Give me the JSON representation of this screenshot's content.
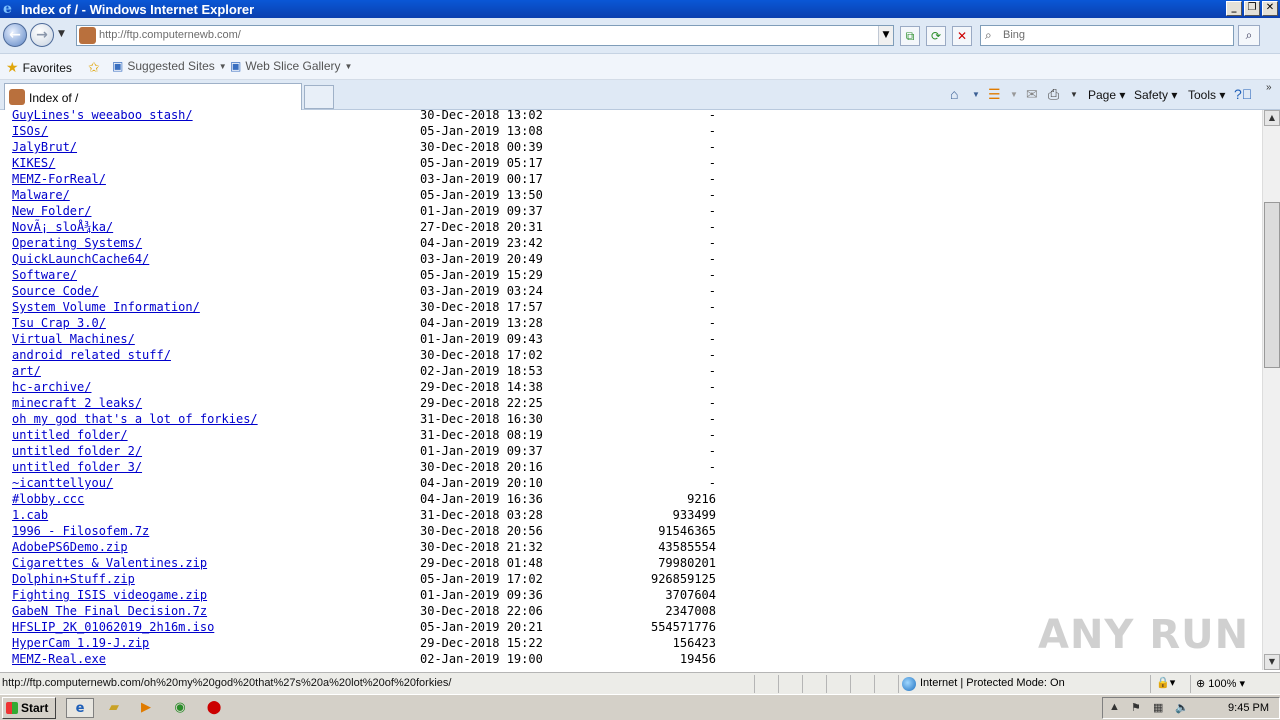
{
  "window": {
    "title": "Index of / - Windows Internet Explorer"
  },
  "nav": {
    "url": "http://ftp.computernewb.com/",
    "search_placeholder": "Bing"
  },
  "favorites_bar": {
    "favorites": "Favorites",
    "suggested": "Suggested Sites",
    "gallery": "Web Slice Gallery"
  },
  "tab": {
    "title": "Index of /"
  },
  "commands": {
    "page": "Page",
    "safety": "Safety",
    "tools": "Tools"
  },
  "listing": [
    {
      "name": "GuyLines's weeaboo stash/",
      "date": "30-Dec-2018 13:02",
      "size": "-"
    },
    {
      "name": "ISOs/",
      "date": "05-Jan-2019 13:08",
      "size": "-"
    },
    {
      "name": "JalyBrut/",
      "date": "30-Dec-2018 00:39",
      "size": "-"
    },
    {
      "name": "KIKES/",
      "date": "05-Jan-2019 05:17",
      "size": "-"
    },
    {
      "name": "MEMZ-ForReal/",
      "date": "03-Jan-2019 00:17",
      "size": "-"
    },
    {
      "name": "Malware/",
      "date": "05-Jan-2019 13:50",
      "size": "-"
    },
    {
      "name": "New Folder/",
      "date": "01-Jan-2019 09:37",
      "size": "-"
    },
    {
      "name": "NovÃ¡ sloÅ¾ka/",
      "date": "27-Dec-2018 20:31",
      "size": "-"
    },
    {
      "name": "Operating Systems/",
      "date": "04-Jan-2019 23:42",
      "size": "-"
    },
    {
      "name": "QuickLaunchCache64/",
      "date": "03-Jan-2019 20:49",
      "size": "-"
    },
    {
      "name": "Software/",
      "date": "05-Jan-2019 15:29",
      "size": "-"
    },
    {
      "name": "Source Code/",
      "date": "03-Jan-2019 03:24",
      "size": "-"
    },
    {
      "name": "System Volume Information/",
      "date": "30-Dec-2018 17:57",
      "size": "-"
    },
    {
      "name": "Tsu Crap 3.0/",
      "date": "04-Jan-2019 13:28",
      "size": "-"
    },
    {
      "name": "Virtual Machines/",
      "date": "01-Jan-2019 09:43",
      "size": "-"
    },
    {
      "name": "android related stuff/",
      "date": "30-Dec-2018 17:02",
      "size": "-"
    },
    {
      "name": "art/",
      "date": "02-Jan-2019 18:53",
      "size": "-"
    },
    {
      "name": "hc-archive/",
      "date": "29-Dec-2018 14:38",
      "size": "-"
    },
    {
      "name": "minecraft 2 leaks/",
      "date": "29-Dec-2018 22:25",
      "size": "-"
    },
    {
      "name": "oh my god that's a lot of forkies/",
      "date": "31-Dec-2018 16:30",
      "size": "-"
    },
    {
      "name": "untitled folder/",
      "date": "31-Dec-2018 08:19",
      "size": "-"
    },
    {
      "name": "untitled folder 2/",
      "date": "01-Jan-2019 09:37",
      "size": "-"
    },
    {
      "name": "untitled folder 3/",
      "date": "30-Dec-2018 20:16",
      "size": "-"
    },
    {
      "name": "~icanttellyou/",
      "date": "04-Jan-2019 20:10",
      "size": "-"
    },
    {
      "name": "#lobby.ccc",
      "date": "04-Jan-2019 16:36",
      "size": "9216"
    },
    {
      "name": "1.cab",
      "date": "31-Dec-2018 03:28",
      "size": "933499"
    },
    {
      "name": "1996 - Filosofem.7z",
      "date": "30-Dec-2018 20:56",
      "size": "91546365"
    },
    {
      "name": "AdobePS6Demo.zip",
      "date": "30-Dec-2018 21:32",
      "size": "43585554"
    },
    {
      "name": "Cigarettes & Valentines.zip",
      "date": "29-Dec-2018 01:48",
      "size": "79980201"
    },
    {
      "name": "Dolphin+Stuff.zip",
      "date": "05-Jan-2019 17:02",
      "size": "926859125"
    },
    {
      "name": "Fighting ISIS videogame.zip",
      "date": "01-Jan-2019 09:36",
      "size": "3707604"
    },
    {
      "name": "GabeN The Final Decision.7z",
      "date": "30-Dec-2018 22:06",
      "size": "2347008"
    },
    {
      "name": "HFSLIP_2K_01062019_2h16m.iso",
      "date": "05-Jan-2019 20:21",
      "size": "554571776"
    },
    {
      "name": "HyperCam 1.19-J.zip",
      "date": "29-Dec-2018 15:22",
      "size": "156423"
    },
    {
      "name": "MEMZ-Real.exe",
      "date": "02-Jan-2019 19:00",
      "size": "19456"
    }
  ],
  "statusbar": {
    "url": "http://ftp.computernewb.com/oh%20my%20god%20that%27s%20a%20lot%20of%20forkies/",
    "zone": "Internet | Protected Mode: On",
    "zoom": "100%"
  },
  "taskbar": {
    "start": "Start",
    "clock": "9:45 PM"
  },
  "watermark": "ANY RUN"
}
